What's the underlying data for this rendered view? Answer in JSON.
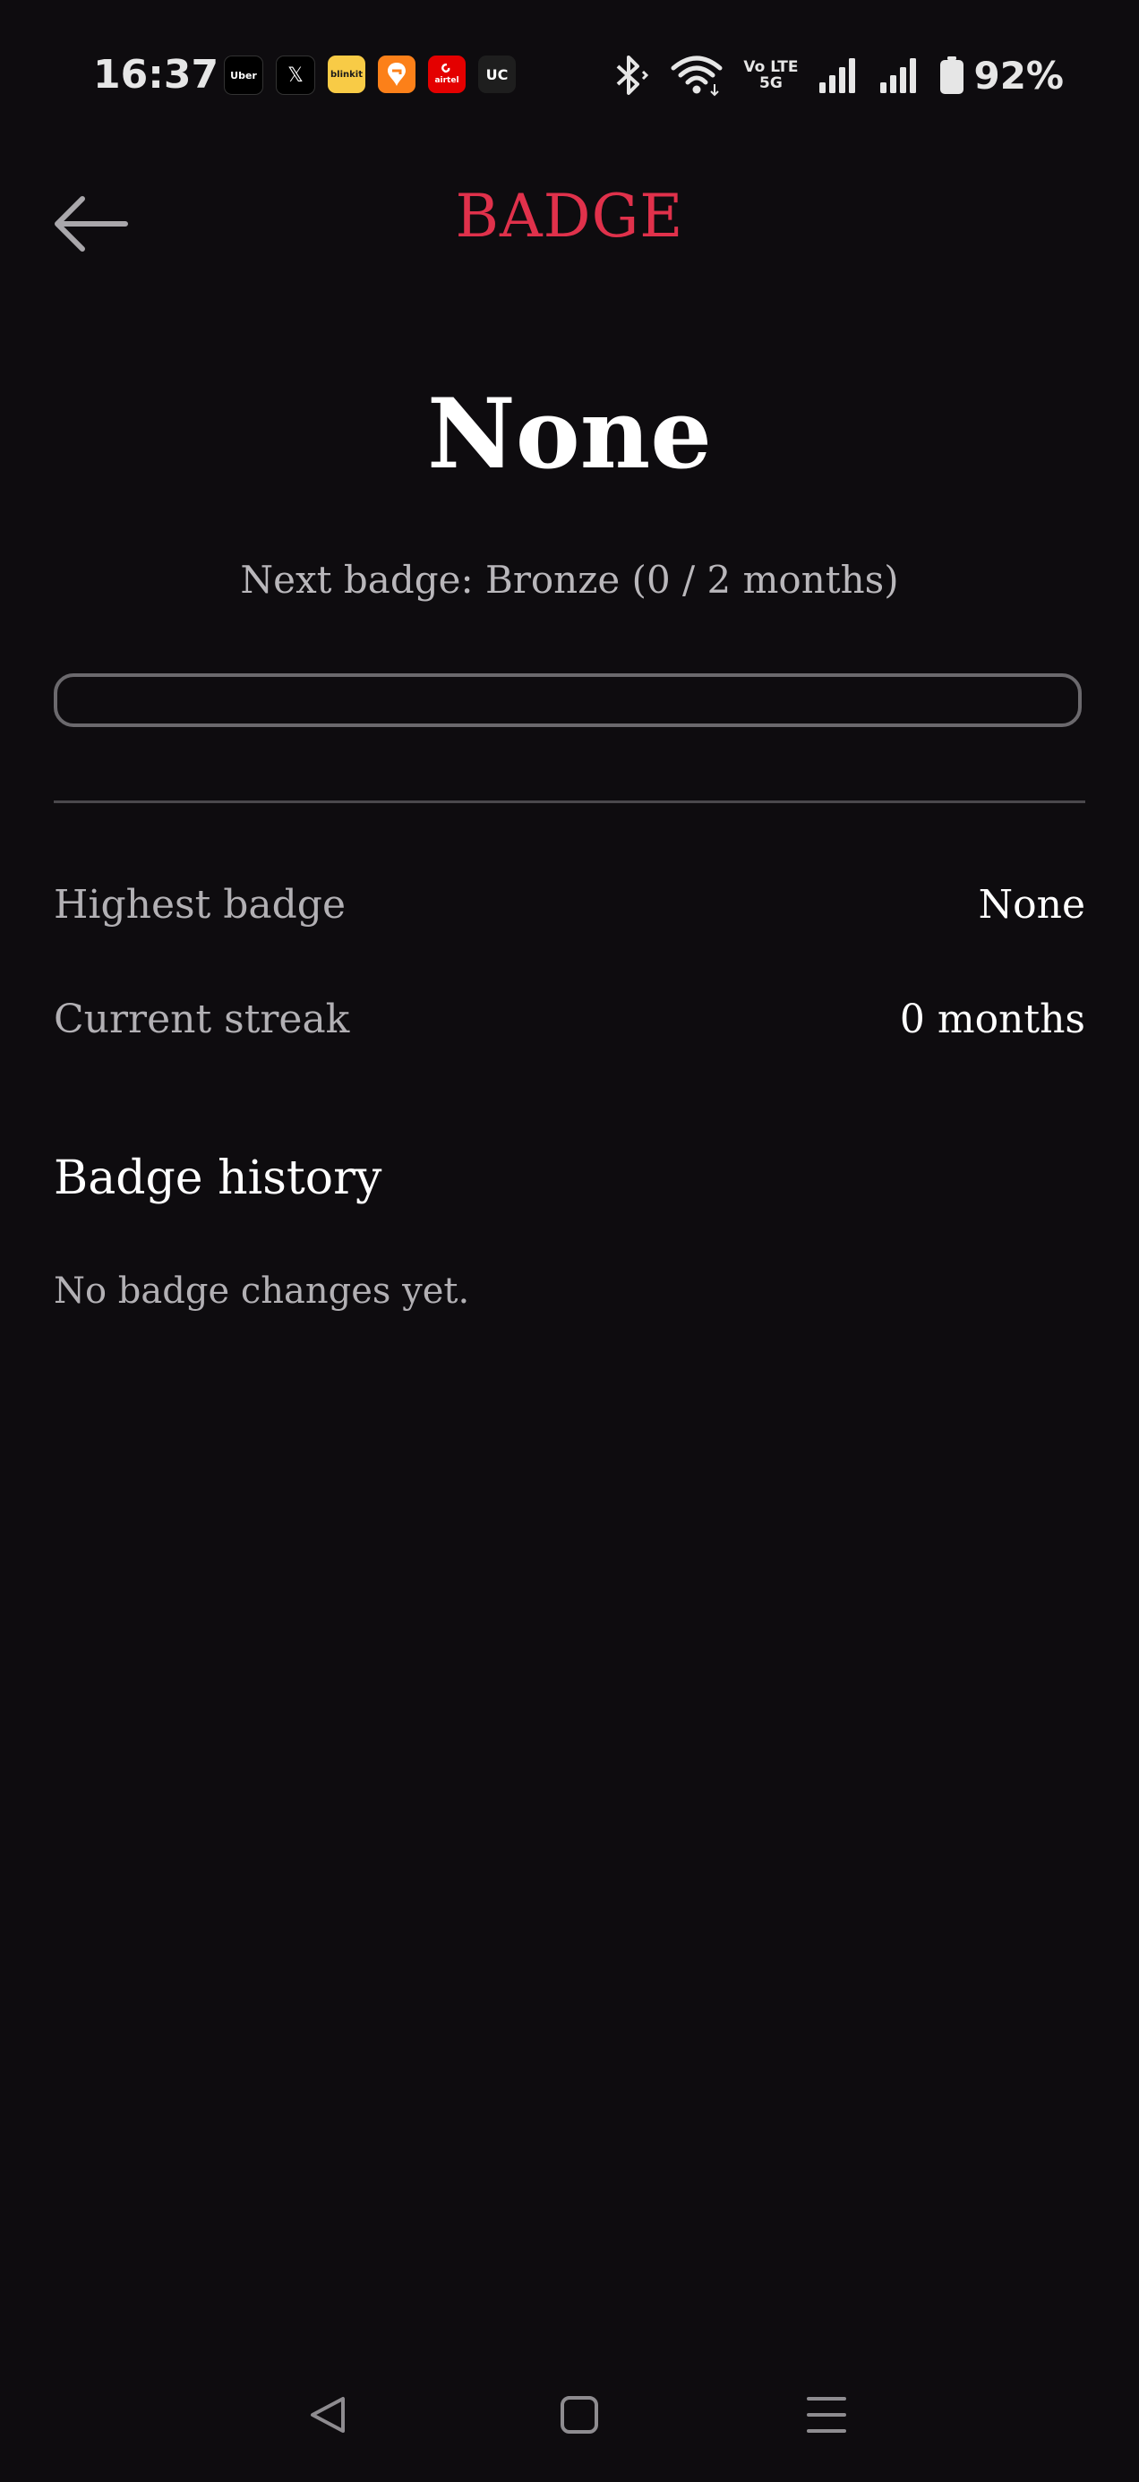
{
  "status_bar": {
    "time": "16:37",
    "notifications": [
      {
        "icon": "uber-icon",
        "label": "Uber",
        "bg": "#000000"
      },
      {
        "icon": "x-icon",
        "label": "𝕏",
        "bg": "#000000"
      },
      {
        "icon": "blinkit-icon",
        "label": "blinkit",
        "bg": "#f8cb46"
      },
      {
        "icon": "swiggy-icon",
        "label": "",
        "bg": "#fc8019"
      },
      {
        "icon": "airtel-icon",
        "label": "airtel",
        "bg": "#e40000"
      },
      {
        "icon": "uc-icon",
        "label": "UC",
        "bg": "#1e1e1e"
      }
    ],
    "volte_line1": "Vo LTE",
    "volte_line2": "5G",
    "battery": "92%"
  },
  "header": {
    "title": "BADGE",
    "title_color": "#e0314b",
    "back_icon": "arrow-left-icon"
  },
  "badge": {
    "current": "None",
    "next_label": "Next badge: Bronze (0 / 2 months)",
    "progress": 0
  },
  "stats": [
    {
      "label": "Highest badge",
      "value": "None"
    },
    {
      "label": "Current streak",
      "value": "0 months"
    }
  ],
  "history": {
    "title": "Badge history",
    "empty_text": "No badge changes yet."
  },
  "nav": {
    "back_icon": "nav-back-icon",
    "home_icon": "nav-home-icon",
    "recents_icon": "nav-recents-icon"
  }
}
